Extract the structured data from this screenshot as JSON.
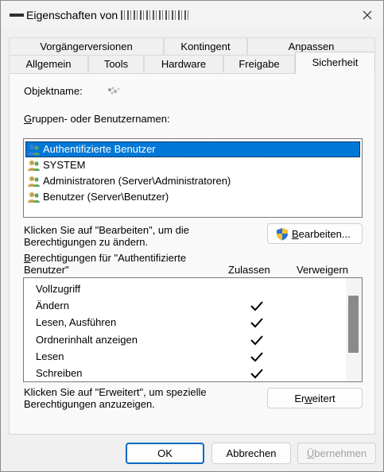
{
  "window": {
    "title": "Eigenschaften von",
    "title_name_obscured": ""
  },
  "tabs": {
    "row1": [
      "Vorgängerversionen",
      "Kontingent",
      "Anpassen"
    ],
    "row2": [
      "Allgemein",
      "Tools",
      "Hardware",
      "Freigabe",
      "Sicherheit"
    ],
    "active": "Sicherheit"
  },
  "security": {
    "object_label": "Objektname:",
    "groups_label_pre": "",
    "groups_label_ul": "G",
    "groups_label_post": "ruppen- oder Benutzernamen:",
    "groups": [
      {
        "label": "Authentifizierte Benutzer",
        "selected": true
      },
      {
        "label": "SYSTEM",
        "selected": false
      },
      {
        "label": "Administratoren (Server\\Administratoren)",
        "selected": false
      },
      {
        "label": "Benutzer (Server\\Benutzer)",
        "selected": false
      }
    ],
    "edit_hint_line1": "Klicken Sie auf \"Bearbeiten\", um die",
    "edit_hint_line2": "Berechtigungen zu ändern.",
    "edit_button_pre": "",
    "edit_button_ul": "B",
    "edit_button_post": "earbeiten...",
    "perm_label_line1_pre": "",
    "perm_label_line1_ul": "B",
    "perm_label_line1_post": "erechtigungen für \"Authentifizierte",
    "perm_label_line2": "Benutzer\"",
    "col_allow": "Zulassen",
    "col_deny": "Verweigern",
    "permissions": [
      {
        "name": "Vollzugriff",
        "allow": false,
        "deny": false
      },
      {
        "name": "Ändern",
        "allow": true,
        "deny": false
      },
      {
        "name": "Lesen, Ausführen",
        "allow": true,
        "deny": false
      },
      {
        "name": "Ordnerinhalt anzeigen",
        "allow": true,
        "deny": false
      },
      {
        "name": "Lesen",
        "allow": true,
        "deny": false
      },
      {
        "name": "Schreiben",
        "allow": true,
        "deny": false
      }
    ],
    "advanced_hint_line1": "Klicken Sie auf \"Erweitert\", um spezielle",
    "advanced_hint_line2": "Berechtigungen anzuzeigen.",
    "advanced_button_pre": "Er",
    "advanced_button_ul": "w",
    "advanced_button_post": "eitert"
  },
  "footer": {
    "ok": "OK",
    "cancel": "Abbrechen",
    "apply_pre": "",
    "apply_ul": "Ü",
    "apply_post": "bernehmen"
  },
  "colors": {
    "selection": "#0078d7",
    "primary_border": "#0067c0",
    "window_bg": "#f0f0f0",
    "panel_bg": "#f9f9f9"
  }
}
